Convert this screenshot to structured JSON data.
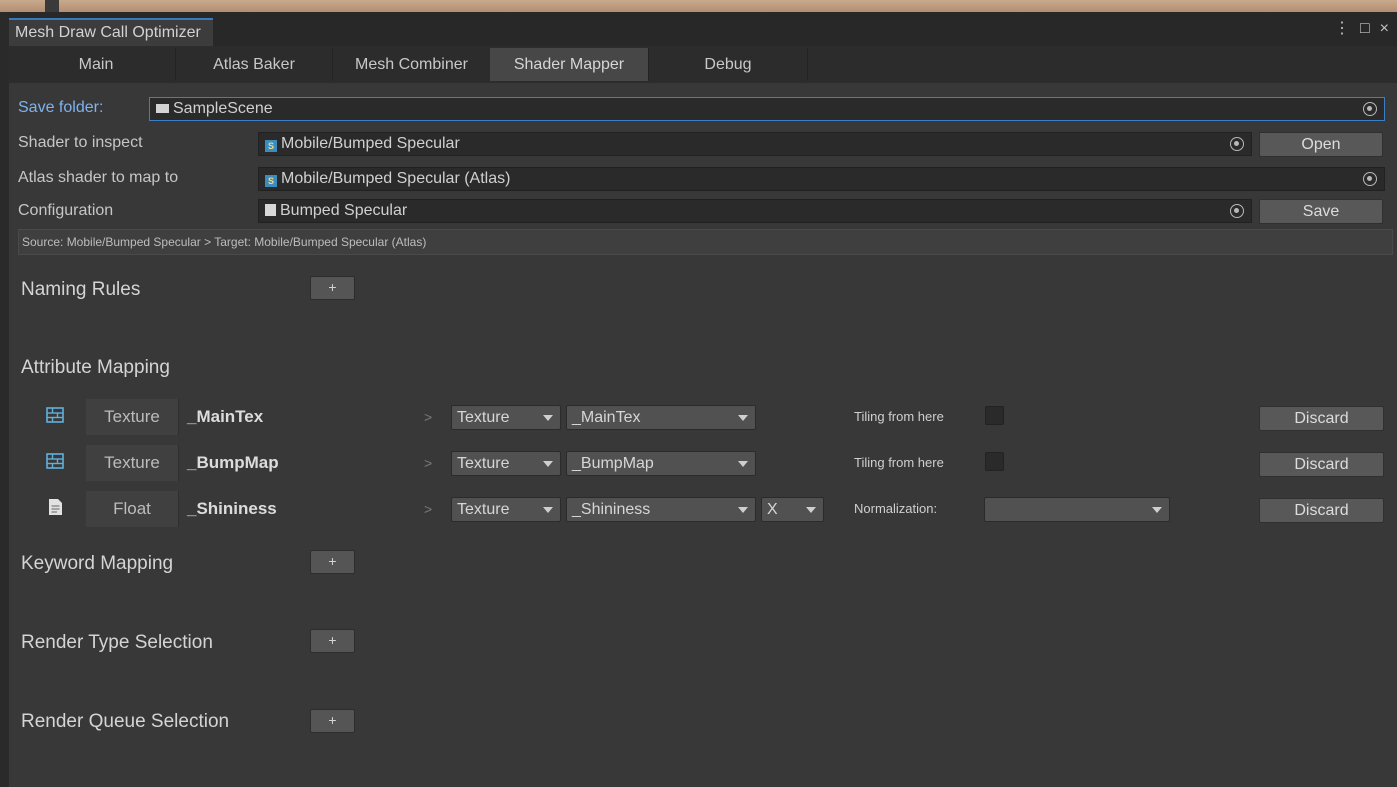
{
  "window": {
    "title": "Mesh Draw Call Optimizer",
    "controls": {
      "menu": "⋮",
      "maximize": "□",
      "close": "×"
    }
  },
  "tabs": [
    {
      "label": "Main",
      "active": false
    },
    {
      "label": "Atlas Baker",
      "active": false
    },
    {
      "label": "Mesh Combiner",
      "active": false
    },
    {
      "label": "Shader Mapper",
      "active": true
    },
    {
      "label": "Debug",
      "active": false
    }
  ],
  "fields": {
    "save_folder": {
      "label": "Save folder:",
      "value": "SampleScene",
      "icon": "folder-icon"
    },
    "shader_inspect": {
      "label": "Shader to inspect",
      "value": "Mobile/Bumped Specular",
      "icon": "shader-icon",
      "button": "Open"
    },
    "atlas_shader": {
      "label": "Atlas shader to map to",
      "value": "Mobile/Bumped Specular (Atlas)",
      "icon": "shader-icon"
    },
    "configuration": {
      "label": "Configuration",
      "value": "Bumped Specular",
      "icon": "document-icon",
      "button": "Save"
    }
  },
  "info_text": "Source: Mobile/Bumped Specular > Target: Mobile/Bumped Specular (Atlas)",
  "sections": {
    "naming_rules": "Naming Rules",
    "attribute_mapping": "Attribute Mapping",
    "keyword_mapping": "Keyword Mapping",
    "render_type_selection": "Render Type Selection",
    "render_queue_selection": "Render Queue Selection",
    "add_label": "+"
  },
  "attributes": [
    {
      "icon": "texture-icon",
      "type": "Texture",
      "name": "_MainTex",
      "separator": ">",
      "target_type": "Texture",
      "target_prop": "_MainTex",
      "option_label": "Tiling from here",
      "discard": "Discard"
    },
    {
      "icon": "texture-icon",
      "type": "Texture",
      "name": "_BumpMap",
      "separator": ">",
      "target_type": "Texture",
      "target_prop": "_BumpMap",
      "option_label": "Tiling from here",
      "discard": "Discard"
    },
    {
      "icon": "document-icon",
      "type": "Float",
      "name": "_Shininess",
      "separator": ">",
      "target_type": "Texture",
      "target_prop": "_Shininess",
      "channel": "X",
      "option_label": "Normalization:",
      "normalization_value": "",
      "discard": "Discard"
    }
  ],
  "colors": {
    "accent": "#3d7fc6",
    "label_blue": "#7fb3ee",
    "background": "#383838"
  }
}
